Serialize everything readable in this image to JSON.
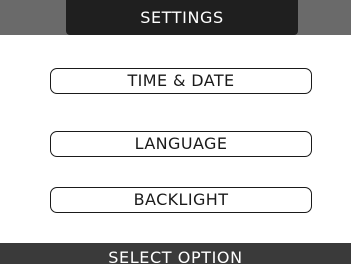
{
  "header": {
    "title": "SETTINGS"
  },
  "menu": {
    "items": [
      {
        "label": "TIME & DATE"
      },
      {
        "label": "LANGUAGE"
      },
      {
        "label": "BACKLIGHT"
      }
    ]
  },
  "footer": {
    "prompt": "SELECT OPTION"
  },
  "colors": {
    "header_bar": "#6a6a6a",
    "header_tab": "#1f1f1f",
    "footer_bar": "#3a3a3a",
    "background": "#ffffff",
    "button_border": "#1a1a1a"
  }
}
